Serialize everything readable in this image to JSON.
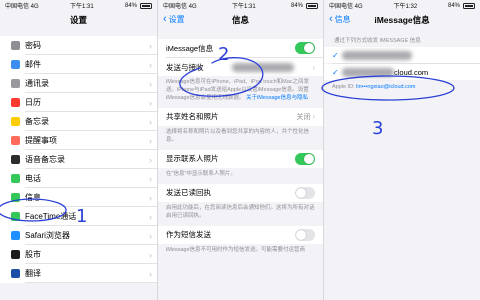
{
  "status_bars": [
    {
      "carrier": "中国电信 4G",
      "time": "下午1:31",
      "battery": "84%"
    },
    {
      "carrier": "中国电信 4G",
      "time": "下午1:31",
      "battery": "84%"
    },
    {
      "carrier": "中国电信 4G",
      "time": "下午1:32",
      "battery": "84%"
    }
  ],
  "settings": {
    "title": "设置",
    "items": [
      {
        "label": "密码",
        "icon": "key-icon",
        "color": "#8e8e93"
      },
      {
        "label": "邮件",
        "icon": "mail-icon",
        "color": "#3b8ef0"
      },
      {
        "label": "通讯录",
        "icon": "contacts-icon",
        "color": "#9a9a9e"
      },
      {
        "label": "日历",
        "icon": "calendar-icon",
        "color": "#ff3b30"
      },
      {
        "label": "备忘录",
        "icon": "notes-icon",
        "color": "#ffcc00"
      },
      {
        "label": "提醒事项",
        "icon": "reminders-icon",
        "color": "#ff6b5b"
      },
      {
        "label": "语音备忘录",
        "icon": "voice-memos-icon",
        "color": "#2c2c2e"
      },
      {
        "label": "电话",
        "icon": "phone-icon",
        "color": "#34c759"
      },
      {
        "label": "信息",
        "icon": "messages-icon",
        "color": "#34c759"
      },
      {
        "label": "FaceTime通话",
        "icon": "facetime-icon",
        "color": "#34c759"
      },
      {
        "label": "Safari浏览器",
        "icon": "safari-icon",
        "color": "#1e90ff"
      },
      {
        "label": "股市",
        "icon": "stocks-icon",
        "color": "#1c1c1e"
      },
      {
        "label": "翻译",
        "icon": "translate-icon",
        "color": "#1c4ea8"
      }
    ]
  },
  "messages": {
    "back": "设置",
    "title": "信息",
    "imessage_label": "iMessage信息",
    "send_receive_label": "发送与接收",
    "imessage_note": "iMessage信息可在iPhone、iPad、iPod touch和Mac之间发送。iPhone与iPad发送给Apple以设置iMessage信息。设置iMessage信息会使用无线数据。",
    "imessage_note_link": "关于iMessage信息与隐私",
    "share_name_label": "共享姓名和照片",
    "share_name_value": "关闭",
    "share_name_note": "选择将名称和照片以及看到您共享的内容的人，共个性化信息。",
    "contact_photos_label": "显示联系人照片",
    "contact_photos_note": "在\"信息\"中显示联系人照片。",
    "read_receipts_label": "发送已读回执",
    "read_receipts_note": "启用此功能后，在您阅读信息后会通知他们。这将为所有对话启用已读回执。",
    "sms_label": "作为短信发送",
    "sms_note": "iMessage信息不可用时作为短信发送。可能需要付运营商"
  },
  "imessage": {
    "back": "信息",
    "title": "iMessage信息",
    "section_header": "通过下列方式收发 IMESSAGE 信息",
    "email_suffix": "cloud.com",
    "apple_id_label": "Apple ID:",
    "apple_id_value": "lin•••ngxiao@icloud.com"
  },
  "annotations": [
    "2",
    "1",
    "3"
  ]
}
